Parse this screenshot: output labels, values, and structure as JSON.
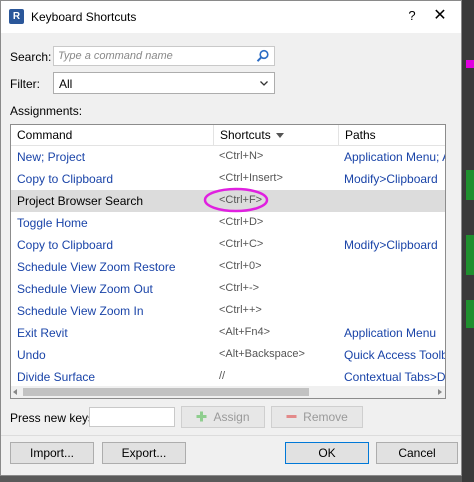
{
  "window": {
    "title": "Keyboard Shortcuts",
    "help_glyph": "?",
    "close_glyph": "✕",
    "app_badge": "R"
  },
  "search": {
    "label": "Search:",
    "placeholder": "Type a command name",
    "value": ""
  },
  "filter": {
    "label": "Filter:",
    "value": "All"
  },
  "assignments": {
    "label": "Assignments:",
    "columns": [
      "Command",
      "Shortcuts",
      "Paths"
    ],
    "rows": [
      {
        "command": "New; Project",
        "shortcut": "<Ctrl+N>",
        "path": "Application Menu; App"
      },
      {
        "command": "Copy to Clipboard",
        "shortcut": "<Ctrl+Insert>",
        "path": "Modify>Clipboard"
      },
      {
        "command": "Project Browser Search",
        "shortcut": "<Ctrl+F>",
        "path": ""
      },
      {
        "command": "Toggle Home",
        "shortcut": "<Ctrl+D>",
        "path": ""
      },
      {
        "command": "Copy to Clipboard",
        "shortcut": "<Ctrl+C>",
        "path": "Modify>Clipboard"
      },
      {
        "command": "Schedule View Zoom Restore",
        "shortcut": "<Ctrl+0>",
        "path": ""
      },
      {
        "command": "Schedule View Zoom Out",
        "shortcut": "<Ctrl+->",
        "path": ""
      },
      {
        "command": "Schedule View Zoom In",
        "shortcut": "<Ctrl++>",
        "path": ""
      },
      {
        "command": "Exit Revit",
        "shortcut": "<Alt+Fn4>",
        "path": "Application Menu"
      },
      {
        "command": "Undo",
        "shortcut": "<Alt+Backspace>",
        "path": "Quick Access Toolbar"
      },
      {
        "command": "Divide Surface",
        "shortcut": "//",
        "path": "Contextual Tabs>Divid"
      }
    ],
    "selected_index": 2
  },
  "press_keys": {
    "label": "Press new keys:",
    "value": ""
  },
  "buttons": {
    "assign": "Assign",
    "remove": "Remove",
    "import": "Import...",
    "export": "Export...",
    "ok": "OK",
    "cancel": "Cancel"
  },
  "colors": {
    "link_text": "#1a44a8",
    "highlight_ring": "#e020e0",
    "selected_row": "#dcdcdc",
    "primary_border": "#0078d7"
  }
}
